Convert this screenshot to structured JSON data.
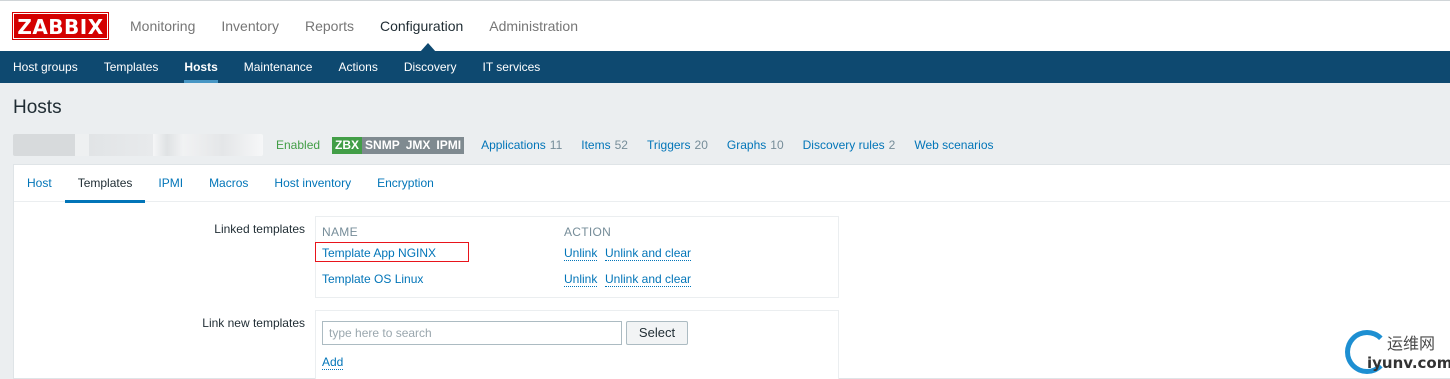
{
  "logo": "ZABBIX",
  "top_nav": [
    "Monitoring",
    "Inventory",
    "Reports",
    "Configuration",
    "Administration"
  ],
  "top_nav_active": "Configuration",
  "sub_nav": [
    "Host groups",
    "Templates",
    "Hosts",
    "Maintenance",
    "Actions",
    "Discovery",
    "IT services"
  ],
  "sub_nav_active": "Hosts",
  "page_title": "Hosts",
  "host": {
    "status": "Enabled",
    "badges": [
      "ZBX",
      "SNMP",
      "JMX",
      "IPMI"
    ],
    "links": [
      {
        "label": "Applications",
        "count": "11"
      },
      {
        "label": "Items",
        "count": "52"
      },
      {
        "label": "Triggers",
        "count": "20"
      },
      {
        "label": "Graphs",
        "count": "10"
      },
      {
        "label": "Discovery rules",
        "count": "2"
      },
      {
        "label": "Web scenarios",
        "count": ""
      }
    ]
  },
  "tabs": [
    "Host",
    "Templates",
    "IPMI",
    "Macros",
    "Host inventory",
    "Encryption"
  ],
  "tab_active": "Templates",
  "linked_templates": {
    "label": "Linked templates",
    "col_name": "NAME",
    "col_action": "ACTION",
    "rows": [
      {
        "name": "Template App NGINX",
        "unlink": "Unlink",
        "unlink_clear": "Unlink and clear"
      },
      {
        "name": "Template OS Linux",
        "unlink": "Unlink",
        "unlink_clear": "Unlink and clear"
      }
    ]
  },
  "link_new": {
    "label": "Link new templates",
    "placeholder": "type here to search",
    "select_button": "Select",
    "add_link": "Add"
  },
  "watermark": {
    "top": "运维网",
    "bottom": "iyunv.com"
  },
  "colors": {
    "brand": "#d40000",
    "nav_bg": "#0e4970",
    "link": "#0275b8",
    "enabled": "#429e47",
    "highlight_border": "#e8141b"
  }
}
